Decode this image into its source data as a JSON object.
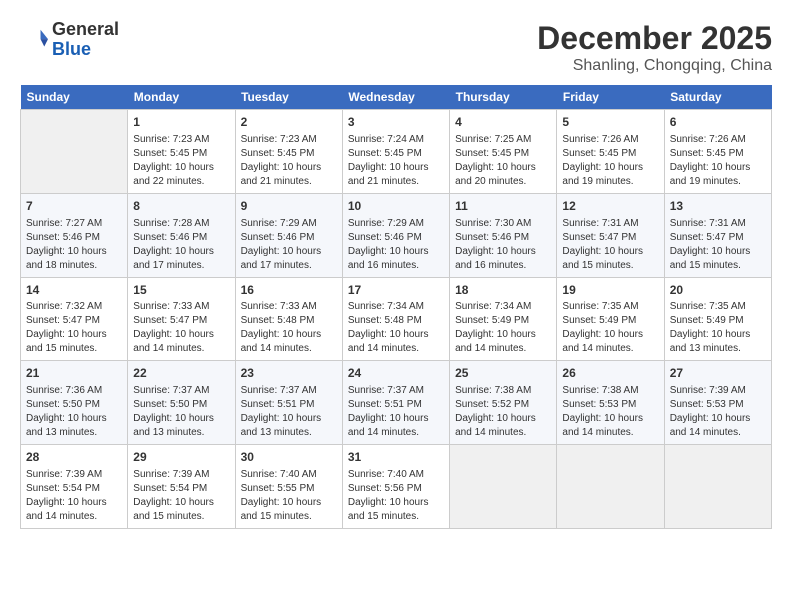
{
  "header": {
    "logo_line1": "General",
    "logo_line2": "Blue",
    "month": "December 2025",
    "location": "Shanling, Chongqing, China"
  },
  "weekdays": [
    "Sunday",
    "Monday",
    "Tuesday",
    "Wednesday",
    "Thursday",
    "Friday",
    "Saturday"
  ],
  "weeks": [
    [
      {
        "day": "",
        "info": ""
      },
      {
        "day": "1",
        "info": "Sunrise: 7:23 AM\nSunset: 5:45 PM\nDaylight: 10 hours\nand 22 minutes."
      },
      {
        "day": "2",
        "info": "Sunrise: 7:23 AM\nSunset: 5:45 PM\nDaylight: 10 hours\nand 21 minutes."
      },
      {
        "day": "3",
        "info": "Sunrise: 7:24 AM\nSunset: 5:45 PM\nDaylight: 10 hours\nand 21 minutes."
      },
      {
        "day": "4",
        "info": "Sunrise: 7:25 AM\nSunset: 5:45 PM\nDaylight: 10 hours\nand 20 minutes."
      },
      {
        "day": "5",
        "info": "Sunrise: 7:26 AM\nSunset: 5:45 PM\nDaylight: 10 hours\nand 19 minutes."
      },
      {
        "day": "6",
        "info": "Sunrise: 7:26 AM\nSunset: 5:45 PM\nDaylight: 10 hours\nand 19 minutes."
      }
    ],
    [
      {
        "day": "7",
        "info": "Sunrise: 7:27 AM\nSunset: 5:46 PM\nDaylight: 10 hours\nand 18 minutes."
      },
      {
        "day": "8",
        "info": "Sunrise: 7:28 AM\nSunset: 5:46 PM\nDaylight: 10 hours\nand 17 minutes."
      },
      {
        "day": "9",
        "info": "Sunrise: 7:29 AM\nSunset: 5:46 PM\nDaylight: 10 hours\nand 17 minutes."
      },
      {
        "day": "10",
        "info": "Sunrise: 7:29 AM\nSunset: 5:46 PM\nDaylight: 10 hours\nand 16 minutes."
      },
      {
        "day": "11",
        "info": "Sunrise: 7:30 AM\nSunset: 5:46 PM\nDaylight: 10 hours\nand 16 minutes."
      },
      {
        "day": "12",
        "info": "Sunrise: 7:31 AM\nSunset: 5:47 PM\nDaylight: 10 hours\nand 15 minutes."
      },
      {
        "day": "13",
        "info": "Sunrise: 7:31 AM\nSunset: 5:47 PM\nDaylight: 10 hours\nand 15 minutes."
      }
    ],
    [
      {
        "day": "14",
        "info": "Sunrise: 7:32 AM\nSunset: 5:47 PM\nDaylight: 10 hours\nand 15 minutes."
      },
      {
        "day": "15",
        "info": "Sunrise: 7:33 AM\nSunset: 5:47 PM\nDaylight: 10 hours\nand 14 minutes."
      },
      {
        "day": "16",
        "info": "Sunrise: 7:33 AM\nSunset: 5:48 PM\nDaylight: 10 hours\nand 14 minutes."
      },
      {
        "day": "17",
        "info": "Sunrise: 7:34 AM\nSunset: 5:48 PM\nDaylight: 10 hours\nand 14 minutes."
      },
      {
        "day": "18",
        "info": "Sunrise: 7:34 AM\nSunset: 5:49 PM\nDaylight: 10 hours\nand 14 minutes."
      },
      {
        "day": "19",
        "info": "Sunrise: 7:35 AM\nSunset: 5:49 PM\nDaylight: 10 hours\nand 14 minutes."
      },
      {
        "day": "20",
        "info": "Sunrise: 7:35 AM\nSunset: 5:49 PM\nDaylight: 10 hours\nand 13 minutes."
      }
    ],
    [
      {
        "day": "21",
        "info": "Sunrise: 7:36 AM\nSunset: 5:50 PM\nDaylight: 10 hours\nand 13 minutes."
      },
      {
        "day": "22",
        "info": "Sunrise: 7:37 AM\nSunset: 5:50 PM\nDaylight: 10 hours\nand 13 minutes."
      },
      {
        "day": "23",
        "info": "Sunrise: 7:37 AM\nSunset: 5:51 PM\nDaylight: 10 hours\nand 13 minutes."
      },
      {
        "day": "24",
        "info": "Sunrise: 7:37 AM\nSunset: 5:51 PM\nDaylight: 10 hours\nand 14 minutes."
      },
      {
        "day": "25",
        "info": "Sunrise: 7:38 AM\nSunset: 5:52 PM\nDaylight: 10 hours\nand 14 minutes."
      },
      {
        "day": "26",
        "info": "Sunrise: 7:38 AM\nSunset: 5:53 PM\nDaylight: 10 hours\nand 14 minutes."
      },
      {
        "day": "27",
        "info": "Sunrise: 7:39 AM\nSunset: 5:53 PM\nDaylight: 10 hours\nand 14 minutes."
      }
    ],
    [
      {
        "day": "28",
        "info": "Sunrise: 7:39 AM\nSunset: 5:54 PM\nDaylight: 10 hours\nand 14 minutes."
      },
      {
        "day": "29",
        "info": "Sunrise: 7:39 AM\nSunset: 5:54 PM\nDaylight: 10 hours\nand 15 minutes."
      },
      {
        "day": "30",
        "info": "Sunrise: 7:40 AM\nSunset: 5:55 PM\nDaylight: 10 hours\nand 15 minutes."
      },
      {
        "day": "31",
        "info": "Sunrise: 7:40 AM\nSunset: 5:56 PM\nDaylight: 10 hours\nand 15 minutes."
      },
      {
        "day": "",
        "info": ""
      },
      {
        "day": "",
        "info": ""
      },
      {
        "day": "",
        "info": ""
      }
    ]
  ]
}
